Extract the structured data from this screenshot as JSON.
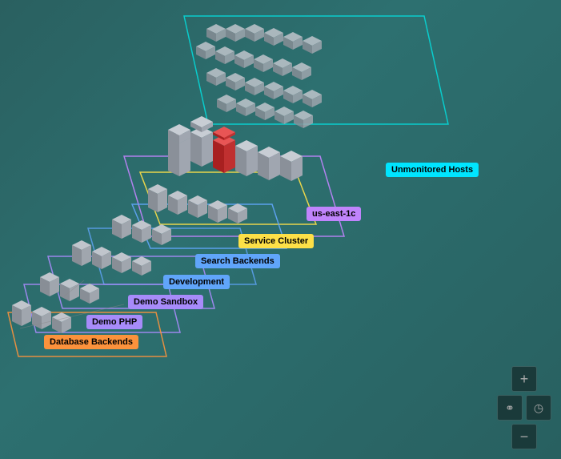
{
  "labels": {
    "unmonitored_hosts": "Unmonitored Hosts",
    "us_east_1c": "us-east-1c",
    "service_cluster": "Service Cluster",
    "search_backends": "Search Backends",
    "development": "Development",
    "demo_sandbox": "Demo Sandbox",
    "demo_php": "Demo PHP",
    "database_backends": "Database Backends"
  },
  "controls": {
    "zoom_in": "+",
    "zoom_out": "−",
    "link_icon": "⚭",
    "clock_icon": "◷"
  },
  "colors": {
    "background": "#2d6b6b",
    "cyan_border": "#00e5e5",
    "purple_border": "#c084fc",
    "yellow_border": "#fde047",
    "blue_border": "#60a5fa",
    "lavender_border": "#a78bfa",
    "orange_border": "#fb923c",
    "server_light": "#c8cdd4",
    "server_dark": "#9aa0a8",
    "server_red": "#e53e3e"
  }
}
